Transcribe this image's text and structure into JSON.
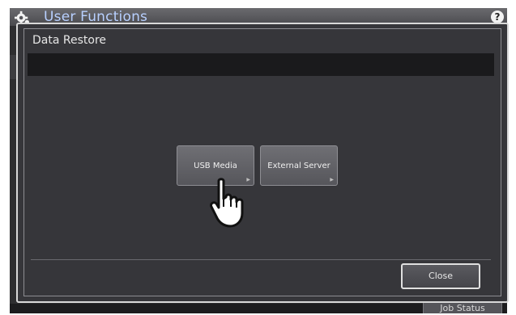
{
  "app": {
    "title": "User Functions",
    "help_label": "?"
  },
  "dialog": {
    "title": "Data Restore",
    "options": [
      {
        "label": "USB Media"
      },
      {
        "label": "External Server"
      }
    ],
    "close_label": "Close"
  },
  "footer": {
    "job_status_label": "Job Status"
  },
  "icons": {
    "settings": "gear-icon",
    "help": "help-icon",
    "button_arrow": "triangle-right-icon",
    "pointer": "hand-pointer-icon"
  },
  "colors": {
    "background": "#2e2e30",
    "title_text": "#b8d0ff",
    "dialog_border": "#d8d8d8"
  }
}
